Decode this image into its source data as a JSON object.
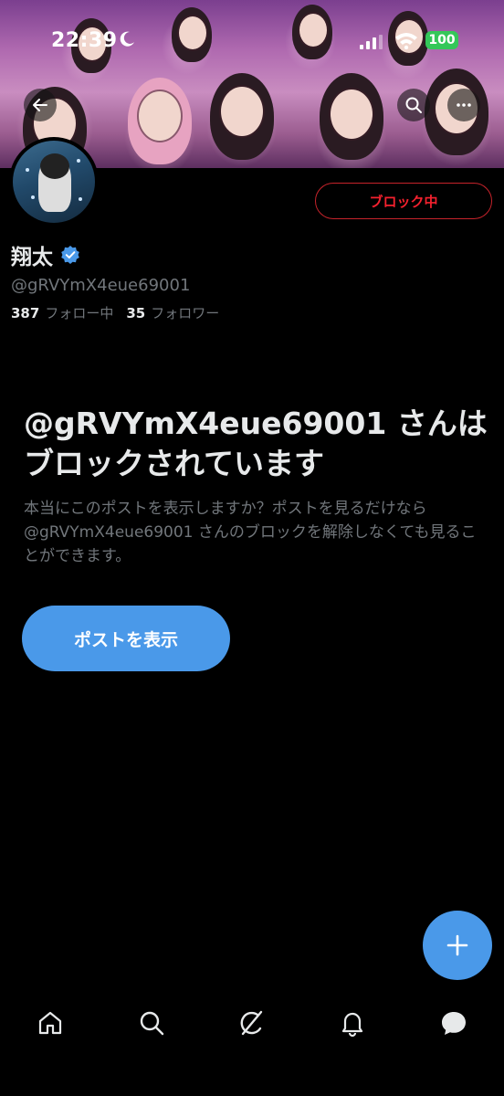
{
  "status_bar": {
    "time": "22:39",
    "battery": "100"
  },
  "profile": {
    "display_name": "翔太",
    "handle": "@gRVYmX4eue69001",
    "following_count": "387",
    "following_label": "フォロー中",
    "followers_count": "35",
    "followers_label": "フォロワー",
    "block_button_label": "ブロック中"
  },
  "blocked_notice": {
    "title": "@gRVYmX4eue69001 さんはブロックされています",
    "description": "本当にこのポストを表示しますか？ポストを見るだけなら @gRVYmX4eue69001 さんのブロックを解除しなくても見ることができます。",
    "show_posts_label": "ポストを表示"
  },
  "colors": {
    "accent": "#4a99e9",
    "danger": "#f4212e",
    "muted_text": "#71767b",
    "primary_text": "#e7e9ea",
    "background": "#000000"
  },
  "icons": {
    "back": "arrow-left-icon",
    "search": "search-icon",
    "more": "more-icon",
    "verified": "verified-badge-icon",
    "compose": "plus-icon",
    "nav": [
      "home-icon",
      "search-icon",
      "grok-icon",
      "bell-icon",
      "chat-icon"
    ]
  }
}
